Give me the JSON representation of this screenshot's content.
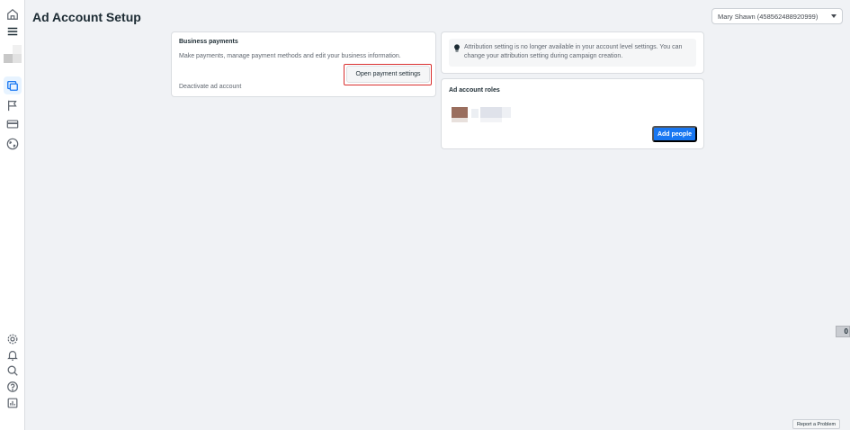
{
  "header": {
    "title": "Ad Account Setup",
    "account_selector": "Mary Shawn (458562488920999)"
  },
  "rail": {
    "top_items": [
      "home-icon",
      "menu-icon",
      "ad-accounts-icon",
      "flag-icon",
      "billing-card-icon",
      "globe-icon"
    ],
    "bottom_items": [
      "settings-icon",
      "notifications-icon",
      "search-icon",
      "help-icon",
      "reports-icon"
    ]
  },
  "business_payments": {
    "title": "Business payments",
    "description": "Make payments, manage payment methods and edit your business information.",
    "open_settings_label": "Open payment settings",
    "deactivate_label": "Deactivate ad account"
  },
  "notice": {
    "text": "Attribution setting is no longer available in your account level settings. You can change your attribution setting during campaign creation."
  },
  "roles": {
    "title": "Ad account roles",
    "add_people_label": "Add people"
  },
  "side_tab": {
    "label": "0"
  },
  "footer": {
    "report_label": "Report a Problem"
  },
  "colors": {
    "primary": "#1877f2",
    "highlight": "#d9302f",
    "active_rail": "#e7f3ff"
  }
}
